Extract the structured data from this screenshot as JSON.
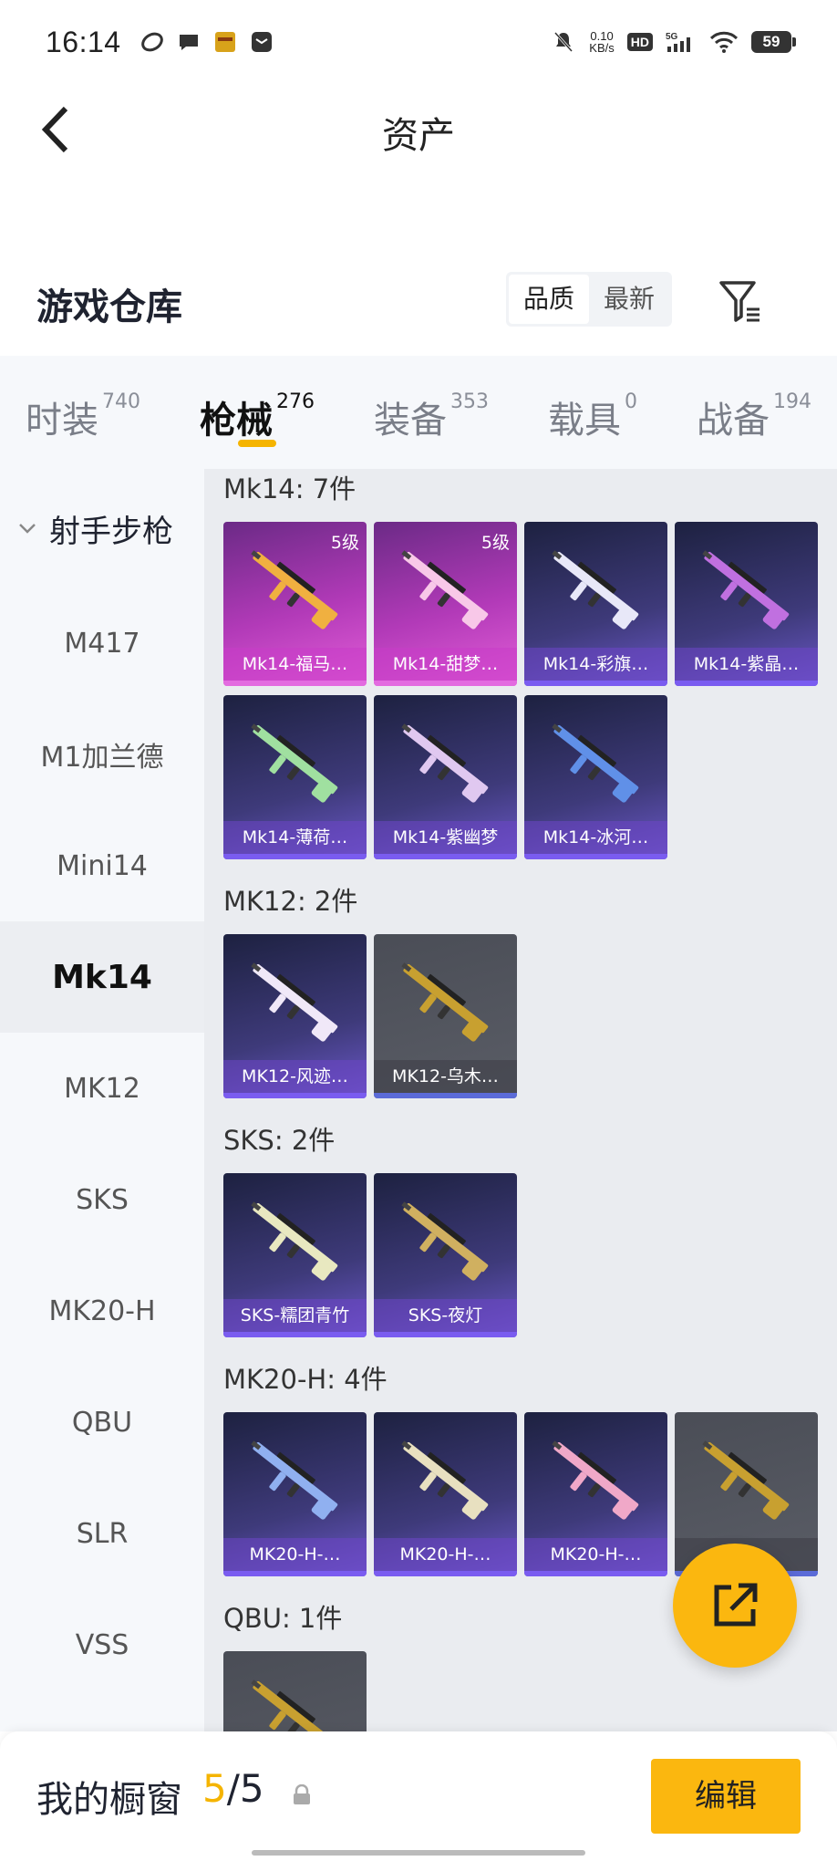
{
  "status_bar": {
    "time": "16:14",
    "net_speed": "0.10",
    "net_unit": "KB/s",
    "hd_label": "HD",
    "signal_label": "5G",
    "battery": "59"
  },
  "header": {
    "title": "资产"
  },
  "warehouse": {
    "title": "游戏仓库",
    "sort": [
      "品质",
      "最新"
    ]
  },
  "tabs": [
    {
      "label": "时装",
      "count": "740"
    },
    {
      "label": "枪械",
      "count": "276"
    },
    {
      "label": "装备",
      "count": "353"
    },
    {
      "label": "载具",
      "count": "0"
    },
    {
      "label": "战备",
      "count": "194"
    }
  ],
  "sidebar": {
    "group": "射手步枪",
    "items": [
      "M417",
      "M1加兰德",
      "Mini14",
      "Mk14",
      "MK12",
      "SKS",
      "MK20-H",
      "QBU",
      "SLR",
      "VSS"
    ]
  },
  "sections": [
    {
      "title": "Mk14: 7件",
      "items": [
        {
          "name": "Mk14-福马…",
          "level": "5级",
          "quality": "pink"
        },
        {
          "name": "Mk14-甜梦…",
          "level": "5级",
          "quality": "pink"
        },
        {
          "name": "Mk14-彩旗…",
          "level": "",
          "quality": "purple"
        },
        {
          "name": "Mk14-紫晶…",
          "level": "",
          "quality": "purple"
        },
        {
          "name": "Mk14-薄荷…",
          "level": "",
          "quality": "purple"
        },
        {
          "name": "Mk14-紫幽梦",
          "level": "",
          "quality": "purple"
        },
        {
          "name": "Mk14-冰河…",
          "level": "",
          "quality": "purple"
        }
      ]
    },
    {
      "title": "MK12: 2件",
      "items": [
        {
          "name": "MK12-风迹…",
          "level": "",
          "quality": "purple"
        },
        {
          "name": "MK12-乌木…",
          "level": "",
          "quality": "grey"
        }
      ]
    },
    {
      "title": "SKS: 2件",
      "items": [
        {
          "name": "SKS-糯团青竹",
          "level": "",
          "quality": "purple"
        },
        {
          "name": "SKS-夜灯",
          "level": "",
          "quality": "purple"
        }
      ]
    },
    {
      "title": "MK20-H: 4件",
      "items": [
        {
          "name": "MK20-H-…",
          "level": "",
          "quality": "purple"
        },
        {
          "name": "MK20-H-…",
          "level": "",
          "quality": "purple"
        },
        {
          "name": "MK20-H-…",
          "level": "",
          "quality": "purple"
        },
        {
          "name": "…",
          "level": "",
          "quality": "grey"
        }
      ]
    },
    {
      "title": "QBU: 1件",
      "items": [
        {
          "name": "",
          "level": "",
          "quality": "grey"
        }
      ]
    }
  ],
  "bottom": {
    "label": "我的橱窗",
    "count_current": "5",
    "count_sep": "/",
    "count_total": "5",
    "edit_label": "编辑"
  },
  "colors": {
    "accent": "#fbb70f",
    "pink_quality": "#e35ed8",
    "purple_quality": "#6b58c8",
    "grey_quality": "#5a5d66"
  },
  "icons": {
    "back": "chevron-left-icon",
    "filter": "filter-icon",
    "share": "share-icon",
    "lock": "lock-icon"
  }
}
